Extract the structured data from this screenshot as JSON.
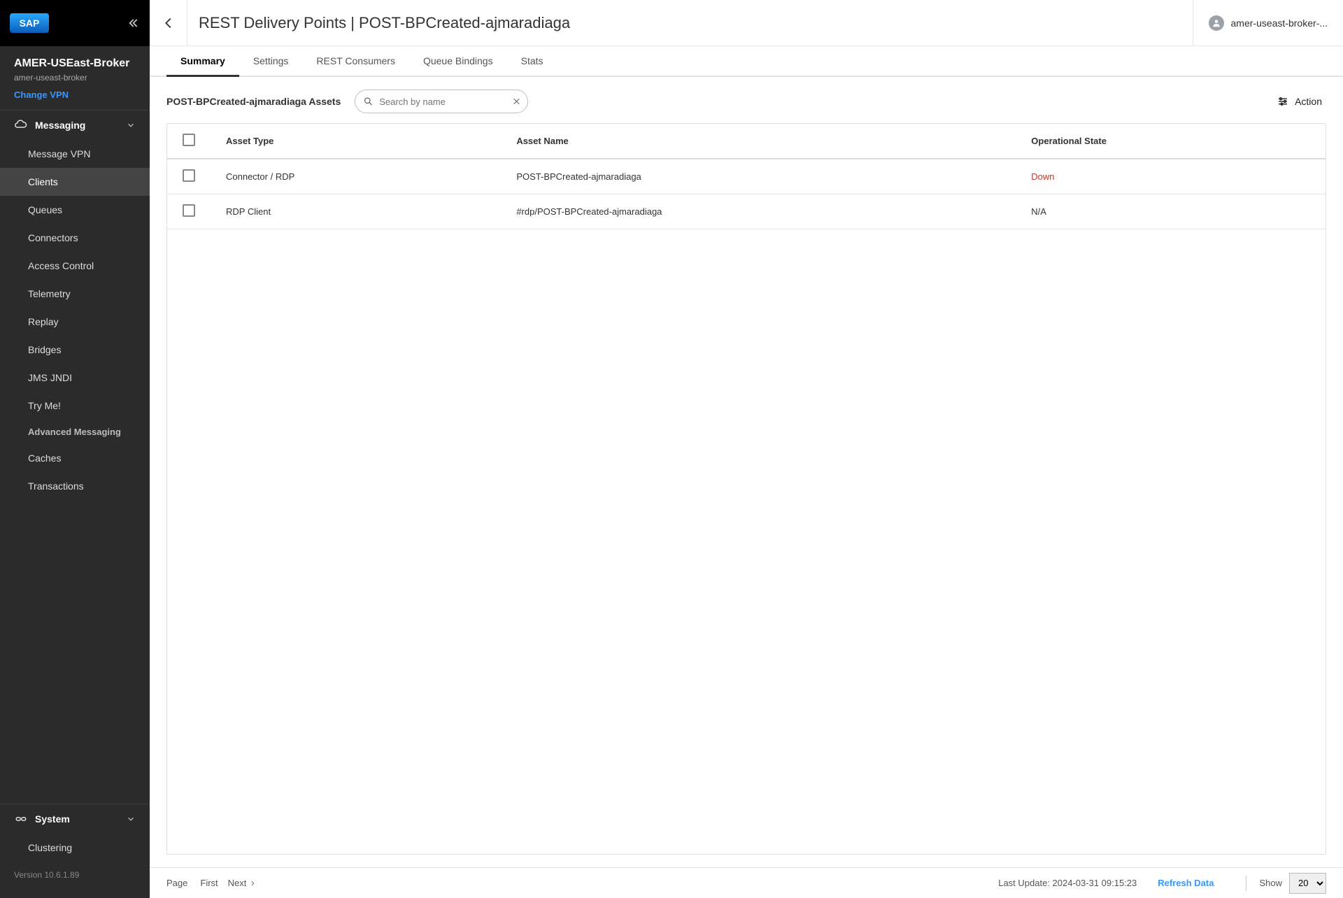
{
  "sidebar": {
    "logo_text": "SAP",
    "broker_name": "AMER-USEast-Broker",
    "broker_sub": "amer-useast-broker",
    "change_vpn": "Change VPN",
    "messaging_label": "Messaging",
    "system_label": "System",
    "items": {
      "message_vpn": "Message VPN",
      "clients": "Clients",
      "queues": "Queues",
      "connectors": "Connectors",
      "access_control": "Access Control",
      "telemetry": "Telemetry",
      "replay": "Replay",
      "bridges": "Bridges",
      "jms_jndi": "JMS JNDI",
      "try_me": "Try Me!",
      "advanced_messaging": "Advanced Messaging",
      "caches": "Caches",
      "transactions": "Transactions",
      "clustering": "Clustering"
    },
    "version_label": "Version 10.6.1.89"
  },
  "header": {
    "page_title": "REST Delivery Points | POST-BPCreated-ajmaradiaga",
    "user_label": "amer-useast-broker-..."
  },
  "tabs": {
    "summary": "Summary",
    "settings": "Settings",
    "rest_consumers": "REST Consumers",
    "queue_bindings": "Queue Bindings",
    "stats": "Stats"
  },
  "toolbar": {
    "assets_title": "POST-BPCreated-ajmaradiaga Assets",
    "search_placeholder": "Search by name",
    "action_label": "Action"
  },
  "table": {
    "cols": {
      "asset_type": "Asset Type",
      "asset_name": "Asset Name",
      "op_state": "Operational State"
    },
    "rows": [
      {
        "asset_type": "Connector / RDP",
        "asset_name": "POST-BPCreated-ajmaradiaga",
        "op_state": "Down",
        "state_class": "state-down"
      },
      {
        "asset_type": "RDP Client",
        "asset_name": "#rdp/POST-BPCreated-ajmaradiaga",
        "op_state": "N/A",
        "state_class": ""
      }
    ]
  },
  "footer": {
    "page_label": "Page",
    "first": "First",
    "next": "Next",
    "last_update": "Last Update: 2024-03-31 09:15:23",
    "refresh": "Refresh Data",
    "show_label": "Show",
    "show_value": "20"
  }
}
